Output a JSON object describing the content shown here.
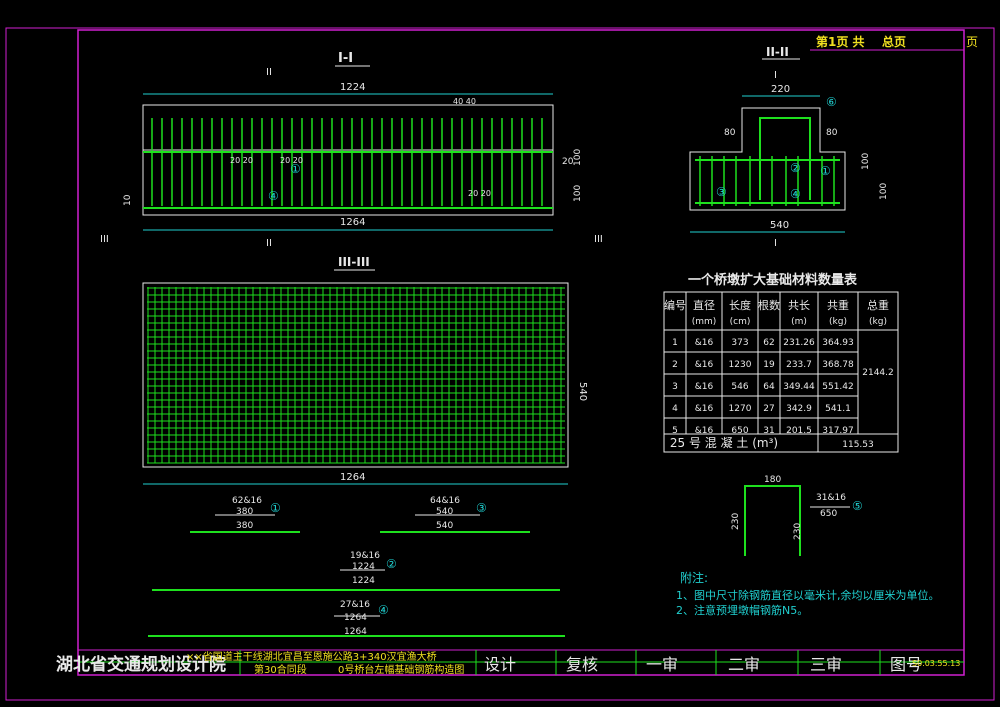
{
  "header": {
    "page_prefix": "第1页 共",
    "page_total": "总页",
    "page_suffix": "页"
  },
  "sections": {
    "s1": "I-I",
    "s2": "II-II",
    "s3": "III-III",
    "cut_ii": "II",
    "cut_iii": "III",
    "cut_i": "I"
  },
  "dims": {
    "d1224": "1224",
    "d4040": "40 40",
    "d2020": "20 20",
    "d20": "20",
    "d100": "100",
    "d10": "10",
    "d1264": "1264",
    "d220": "220",
    "d80": "80",
    "d540": "540",
    "d180": "180",
    "d230": "230"
  },
  "markers": [
    "①",
    "②",
    "③",
    "④",
    "⑤",
    "⑥"
  ],
  "bars": [
    {
      "id": "①",
      "count": "62&16",
      "l1": "380",
      "l2": "380"
    },
    {
      "id": "③",
      "count": "64&16",
      "l1": "540",
      "l2": "540"
    },
    {
      "id": "②",
      "count": "19&16",
      "l1": "1224",
      "l2": "1224"
    },
    {
      "id": "④",
      "count": "27&16",
      "l1": "1264",
      "l2": "1264"
    },
    {
      "id": "⑤",
      "count": "31&16",
      "l1": "650"
    }
  ],
  "table": {
    "title": "一个桥墩扩大基础材料数量表",
    "headers": [
      "编号",
      "直径(mm)",
      "长度(cm)",
      "根数",
      "共长(m)",
      "共重(kg)",
      "总重(kg)"
    ],
    "rows": [
      [
        "1",
        "&16",
        "373",
        "62",
        "231.26",
        "364.93"
      ],
      [
        "2",
        "&16",
        "1230",
        "19",
        "233.7",
        "368.78"
      ],
      [
        "3",
        "&16",
        "546",
        "64",
        "349.44",
        "551.42"
      ],
      [
        "4",
        "&16",
        "1270",
        "27",
        "342.9",
        "541.1"
      ],
      [
        "5",
        "&16",
        "650",
        "31",
        "201.5",
        "317.97"
      ]
    ],
    "total_weight": "2144.2",
    "concrete_label": "25 号 混 凝 土 (m³)",
    "concrete_value": "115.53"
  },
  "notes": {
    "title": "附注:",
    "n1": "1、图中尺寸除钢筋直径以毫米计,余均以厘米为单位。",
    "n2": "2、注意预埋墩帽钢筋N5。"
  },
  "title_block": {
    "org": "湖北省交通规划设计院",
    "project1": "××省国道主干线湖北宜昌至恩施公路3+340汉宜渔大桥",
    "project2": "第30合同段",
    "drawing": "0号桥台左幅基础钢筋构造图",
    "design": "设计",
    "review": "复核",
    "check1": "一审",
    "check2": "二审",
    "check3": "三审",
    "fig_no": "图号",
    "fig_code": "S0.03.55.13"
  },
  "colors": {
    "frame": "#d020d0",
    "line": "#e8e8e8",
    "bar": "#1ee01e",
    "dim": "#20d0d0",
    "yellow": "#f0e020"
  }
}
